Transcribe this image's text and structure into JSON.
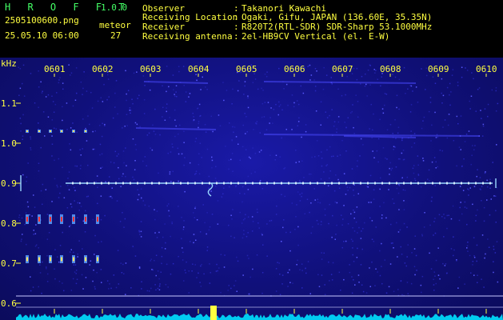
{
  "header": {
    "app_title": "H R O F F T",
    "version": "1.0.0",
    "filename": "2505100600.png",
    "datetime": "25.05.10 06:00",
    "meteor_label": "meteor",
    "meteor_count": "27",
    "info_labels": [
      "Observer",
      "Receiving Location",
      "Receiver",
      "Receiving antenna"
    ],
    "info_separator": ":",
    "info_values": [
      "Takanori Kawachi",
      "Ogaki, Gifu, JAPAN (136.60E, 35.35N)",
      "R820T2(RTL-SDR) SDR-Sharp 53.1000MHz",
      "2el-HB9CV Vertical (el. E-W)"
    ]
  },
  "spectrogram": {
    "y_unit": "kHz",
    "y_ticks": [
      "1.1",
      "1.0",
      "0.9",
      "0.8",
      "0.7",
      "0.6"
    ],
    "y_values": [
      1.1,
      1.0,
      0.9,
      0.8,
      0.7,
      0.6
    ],
    "time_labels": [
      "0601",
      "0602",
      "0603",
      "0604",
      "0605",
      "0606",
      "0607",
      "0608",
      "0609",
      "0610"
    ],
    "time_minutes": [
      1,
      2,
      3,
      4,
      5,
      6,
      7,
      8,
      9,
      10
    ],
    "carrier_khz": 0.9,
    "colors": {
      "background": "#10107a",
      "tick_text": "#ffff40",
      "carrier": "#9ad8ff",
      "signal_hot": "#ff3030",
      "level_trace": "#00e0ff"
    }
  }
}
